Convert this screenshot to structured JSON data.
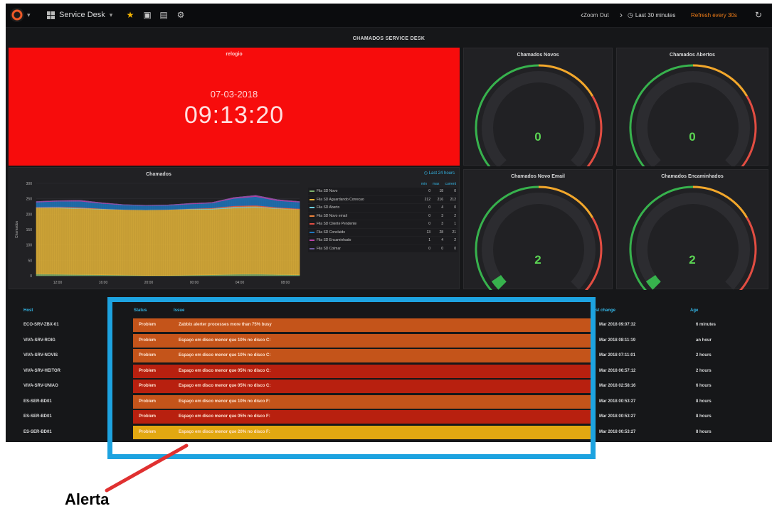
{
  "navbar": {
    "dashboard_title": "Service Desk",
    "zoom_out_label": "Zoom Out",
    "time_range": "Last 30 minutes",
    "refresh_label": "Refresh every 30s"
  },
  "row_title": "CHAMADOS SERVICE DESK",
  "clock": {
    "title": "relogio",
    "date": "07-03-2018",
    "time": "09:13:20",
    "background": "#f70c0c"
  },
  "gauges": [
    {
      "title": "Chamados Novos",
      "value": "0",
      "level": 0
    },
    {
      "title": "Chamados Abertos",
      "value": "0",
      "level": 0
    },
    {
      "title": "Chamados Novo Email",
      "value": "2",
      "level": 0.04
    },
    {
      "title": "Chamados Encaminhados",
      "value": "2",
      "level": 0.04
    }
  ],
  "gauge_colors": {
    "ok": "#37b24d",
    "warn": "#f2a72b",
    "crit": "#e24d42",
    "value": "#5bd453"
  },
  "graph": {
    "title": "Chamados",
    "range_label": "Last 24 hours",
    "legend_headers": [
      "min",
      "max",
      "current"
    ]
  },
  "chart_data": {
    "type": "area",
    "title": "Chamados",
    "ylabel": "Chamados",
    "ylim": [
      0,
      300
    ],
    "yticks": [
      "300",
      "250",
      "200",
      "150",
      "100",
      "50",
      "0"
    ],
    "xticks": [
      "12:00",
      "16:00",
      "20:00",
      "00:00",
      "04:00",
      "08:00"
    ],
    "series": [
      {
        "name": "Fila SD Novo",
        "color": "#7eb26d",
        "min": "0",
        "max": "18",
        "current": "0",
        "values": [
          6,
          5,
          4,
          3,
          2,
          1,
          1,
          2,
          3,
          5,
          6,
          4,
          3
        ]
      },
      {
        "name": "Fila SD Aguardando Correcao",
        "color": "#eab839",
        "min": "212",
        "max": "216",
        "current": "212",
        "values": [
          214,
          215,
          214,
          213,
          213,
          213,
          214,
          214,
          213,
          215,
          216,
          214,
          212
        ]
      },
      {
        "name": "Fila SD Aberto",
        "color": "#6ed0e0",
        "min": "0",
        "max": "4",
        "current": "0",
        "values": [
          1,
          2,
          1,
          1,
          0,
          0,
          0,
          1,
          2,
          3,
          2,
          1,
          0
        ]
      },
      {
        "name": "Fila SD Novo email",
        "color": "#ef843c",
        "min": "0",
        "max": "3",
        "current": "2",
        "values": [
          1,
          1,
          2,
          1,
          0,
          0,
          0,
          1,
          1,
          2,
          3,
          2,
          2
        ]
      },
      {
        "name": "Fila SD Cliente Pendente",
        "color": "#e24d42",
        "min": "0",
        "max": "3",
        "current": "1",
        "values": [
          1,
          1,
          1,
          0,
          0,
          0,
          0,
          0,
          1,
          2,
          2,
          1,
          1
        ]
      },
      {
        "name": "Fila SD Concluido",
        "color": "#1f78c1",
        "min": "13",
        "max": "28",
        "current": "21",
        "values": [
          16,
          18,
          20,
          17,
          15,
          14,
          14,
          15,
          16,
          24,
          28,
          22,
          21
        ]
      },
      {
        "name": "Fila SD Encaminhado",
        "color": "#ba43a9",
        "min": "1",
        "max": "4",
        "current": "2",
        "values": [
          2,
          2,
          3,
          2,
          1,
          1,
          1,
          2,
          2,
          3,
          4,
          3,
          2
        ]
      },
      {
        "name": "Fila SD Colmar",
        "color": "#705da0",
        "min": "0",
        "max": "0",
        "current": "0",
        "values": [
          0,
          0,
          0,
          0,
          0,
          0,
          0,
          0,
          0,
          0,
          0,
          0,
          0
        ]
      }
    ]
  },
  "table": {
    "headers": {
      "host": "Host",
      "status": "Status",
      "issue": "Issue",
      "last_change": "Last change",
      "age": "Age"
    },
    "rows": [
      {
        "host": "ECO-SRV-ZBX-01",
        "status": "Problem",
        "issue": "Zabbix alerter processes more than 75% busy",
        "last_change": "Mar 2018 09:07:32",
        "age": "6 minutes",
        "color": "#c4541a"
      },
      {
        "host": "VIVA-SRV-ROIG",
        "status": "Problem",
        "issue": "Espaço em disco menor que 10% no disco C:",
        "last_change": "Mar 2018 08:11:19",
        "age": "an hour",
        "color": "#c4541a"
      },
      {
        "host": "VIVA-SRV-NOVIS",
        "status": "Problem",
        "issue": "Espaço em disco menor que 10% no disco C:",
        "last_change": "Mar 2018 07:11:01",
        "age": "2 hours",
        "color": "#c4541a"
      },
      {
        "host": "VIVA-SRV-HEITOR",
        "status": "Problem",
        "issue": "Espaço em disco menor que 05% no disco C:",
        "last_change": "Mar 2018 06:57:12",
        "age": "2 hours",
        "color": "#b8200f"
      },
      {
        "host": "VIVA-SRV-UNIAO",
        "status": "Problem",
        "issue": "Espaço em disco menor que 05% no disco C:",
        "last_change": "Mar 2018 02:58:16",
        "age": "6 hours",
        "color": "#b8200f"
      },
      {
        "host": "ES-SER-BD01",
        "status": "Problem",
        "issue": "Espaço em disco menor que 10% no disco F:",
        "last_change": "Mar 2018 00:53:27",
        "age": "8 hours",
        "color": "#c4541a"
      },
      {
        "host": "ES-SER-BD01",
        "status": "Problem",
        "issue": "Espaço em disco menor que 05% no disco F:",
        "last_change": "Mar 2018 00:53:27",
        "age": "8 hours",
        "color": "#b8200f"
      },
      {
        "host": "ES-SER-BD01",
        "status": "Problem",
        "issue": "Espaço em disco menor que 20% no disco F:",
        "last_change": "Mar 2018 00:53:27",
        "age": "8 hours",
        "color": "#e2a811"
      }
    ]
  },
  "annotation": {
    "label": "Alerta",
    "highlight_color": "#1da3e0",
    "arrow_color": "#e03030"
  }
}
